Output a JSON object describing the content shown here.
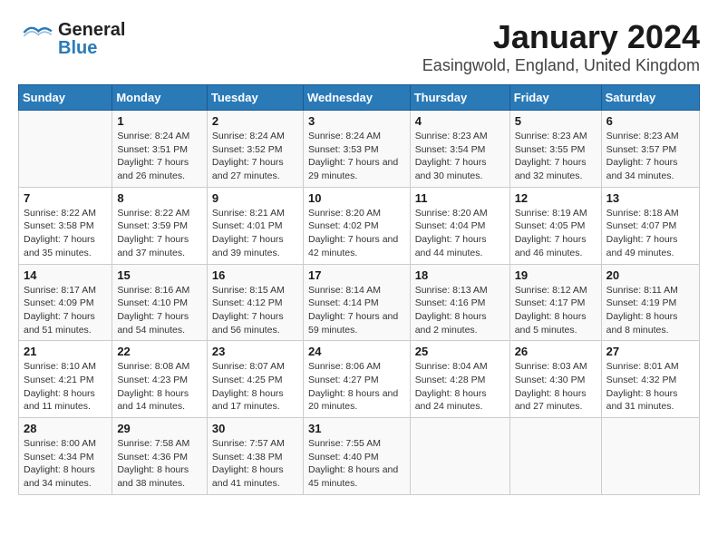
{
  "header": {
    "title": "January 2024",
    "subtitle": "Easingwold, England, United Kingdom",
    "logo_general": "General",
    "logo_blue": "Blue"
  },
  "columns": [
    "Sunday",
    "Monday",
    "Tuesday",
    "Wednesday",
    "Thursday",
    "Friday",
    "Saturday"
  ],
  "weeks": [
    [
      {
        "day": "",
        "sunrise": "",
        "sunset": "",
        "daylight": ""
      },
      {
        "day": "1",
        "sunrise": "Sunrise: 8:24 AM",
        "sunset": "Sunset: 3:51 PM",
        "daylight": "Daylight: 7 hours and 26 minutes."
      },
      {
        "day": "2",
        "sunrise": "Sunrise: 8:24 AM",
        "sunset": "Sunset: 3:52 PM",
        "daylight": "Daylight: 7 hours and 27 minutes."
      },
      {
        "day": "3",
        "sunrise": "Sunrise: 8:24 AM",
        "sunset": "Sunset: 3:53 PM",
        "daylight": "Daylight: 7 hours and 29 minutes."
      },
      {
        "day": "4",
        "sunrise": "Sunrise: 8:23 AM",
        "sunset": "Sunset: 3:54 PM",
        "daylight": "Daylight: 7 hours and 30 minutes."
      },
      {
        "day": "5",
        "sunrise": "Sunrise: 8:23 AM",
        "sunset": "Sunset: 3:55 PM",
        "daylight": "Daylight: 7 hours and 32 minutes."
      },
      {
        "day": "6",
        "sunrise": "Sunrise: 8:23 AM",
        "sunset": "Sunset: 3:57 PM",
        "daylight": "Daylight: 7 hours and 34 minutes."
      }
    ],
    [
      {
        "day": "7",
        "sunrise": "Sunrise: 8:22 AM",
        "sunset": "Sunset: 3:58 PM",
        "daylight": "Daylight: 7 hours and 35 minutes."
      },
      {
        "day": "8",
        "sunrise": "Sunrise: 8:22 AM",
        "sunset": "Sunset: 3:59 PM",
        "daylight": "Daylight: 7 hours and 37 minutes."
      },
      {
        "day": "9",
        "sunrise": "Sunrise: 8:21 AM",
        "sunset": "Sunset: 4:01 PM",
        "daylight": "Daylight: 7 hours and 39 minutes."
      },
      {
        "day": "10",
        "sunrise": "Sunrise: 8:20 AM",
        "sunset": "Sunset: 4:02 PM",
        "daylight": "Daylight: 7 hours and 42 minutes."
      },
      {
        "day": "11",
        "sunrise": "Sunrise: 8:20 AM",
        "sunset": "Sunset: 4:04 PM",
        "daylight": "Daylight: 7 hours and 44 minutes."
      },
      {
        "day": "12",
        "sunrise": "Sunrise: 8:19 AM",
        "sunset": "Sunset: 4:05 PM",
        "daylight": "Daylight: 7 hours and 46 minutes."
      },
      {
        "day": "13",
        "sunrise": "Sunrise: 8:18 AM",
        "sunset": "Sunset: 4:07 PM",
        "daylight": "Daylight: 7 hours and 49 minutes."
      }
    ],
    [
      {
        "day": "14",
        "sunrise": "Sunrise: 8:17 AM",
        "sunset": "Sunset: 4:09 PM",
        "daylight": "Daylight: 7 hours and 51 minutes."
      },
      {
        "day": "15",
        "sunrise": "Sunrise: 8:16 AM",
        "sunset": "Sunset: 4:10 PM",
        "daylight": "Daylight: 7 hours and 54 minutes."
      },
      {
        "day": "16",
        "sunrise": "Sunrise: 8:15 AM",
        "sunset": "Sunset: 4:12 PM",
        "daylight": "Daylight: 7 hours and 56 minutes."
      },
      {
        "day": "17",
        "sunrise": "Sunrise: 8:14 AM",
        "sunset": "Sunset: 4:14 PM",
        "daylight": "Daylight: 7 hours and 59 minutes."
      },
      {
        "day": "18",
        "sunrise": "Sunrise: 8:13 AM",
        "sunset": "Sunset: 4:16 PM",
        "daylight": "Daylight: 8 hours and 2 minutes."
      },
      {
        "day": "19",
        "sunrise": "Sunrise: 8:12 AM",
        "sunset": "Sunset: 4:17 PM",
        "daylight": "Daylight: 8 hours and 5 minutes."
      },
      {
        "day": "20",
        "sunrise": "Sunrise: 8:11 AM",
        "sunset": "Sunset: 4:19 PM",
        "daylight": "Daylight: 8 hours and 8 minutes."
      }
    ],
    [
      {
        "day": "21",
        "sunrise": "Sunrise: 8:10 AM",
        "sunset": "Sunset: 4:21 PM",
        "daylight": "Daylight: 8 hours and 11 minutes."
      },
      {
        "day": "22",
        "sunrise": "Sunrise: 8:08 AM",
        "sunset": "Sunset: 4:23 PM",
        "daylight": "Daylight: 8 hours and 14 minutes."
      },
      {
        "day": "23",
        "sunrise": "Sunrise: 8:07 AM",
        "sunset": "Sunset: 4:25 PM",
        "daylight": "Daylight: 8 hours and 17 minutes."
      },
      {
        "day": "24",
        "sunrise": "Sunrise: 8:06 AM",
        "sunset": "Sunset: 4:27 PM",
        "daylight": "Daylight: 8 hours and 20 minutes."
      },
      {
        "day": "25",
        "sunrise": "Sunrise: 8:04 AM",
        "sunset": "Sunset: 4:28 PM",
        "daylight": "Daylight: 8 hours and 24 minutes."
      },
      {
        "day": "26",
        "sunrise": "Sunrise: 8:03 AM",
        "sunset": "Sunset: 4:30 PM",
        "daylight": "Daylight: 8 hours and 27 minutes."
      },
      {
        "day": "27",
        "sunrise": "Sunrise: 8:01 AM",
        "sunset": "Sunset: 4:32 PM",
        "daylight": "Daylight: 8 hours and 31 minutes."
      }
    ],
    [
      {
        "day": "28",
        "sunrise": "Sunrise: 8:00 AM",
        "sunset": "Sunset: 4:34 PM",
        "daylight": "Daylight: 8 hours and 34 minutes."
      },
      {
        "day": "29",
        "sunrise": "Sunrise: 7:58 AM",
        "sunset": "Sunset: 4:36 PM",
        "daylight": "Daylight: 8 hours and 38 minutes."
      },
      {
        "day": "30",
        "sunrise": "Sunrise: 7:57 AM",
        "sunset": "Sunset: 4:38 PM",
        "daylight": "Daylight: 8 hours and 41 minutes."
      },
      {
        "day": "31",
        "sunrise": "Sunrise: 7:55 AM",
        "sunset": "Sunset: 4:40 PM",
        "daylight": "Daylight: 8 hours and 45 minutes."
      },
      {
        "day": "",
        "sunrise": "",
        "sunset": "",
        "daylight": ""
      },
      {
        "day": "",
        "sunrise": "",
        "sunset": "",
        "daylight": ""
      },
      {
        "day": "",
        "sunrise": "",
        "sunset": "",
        "daylight": ""
      }
    ]
  ]
}
